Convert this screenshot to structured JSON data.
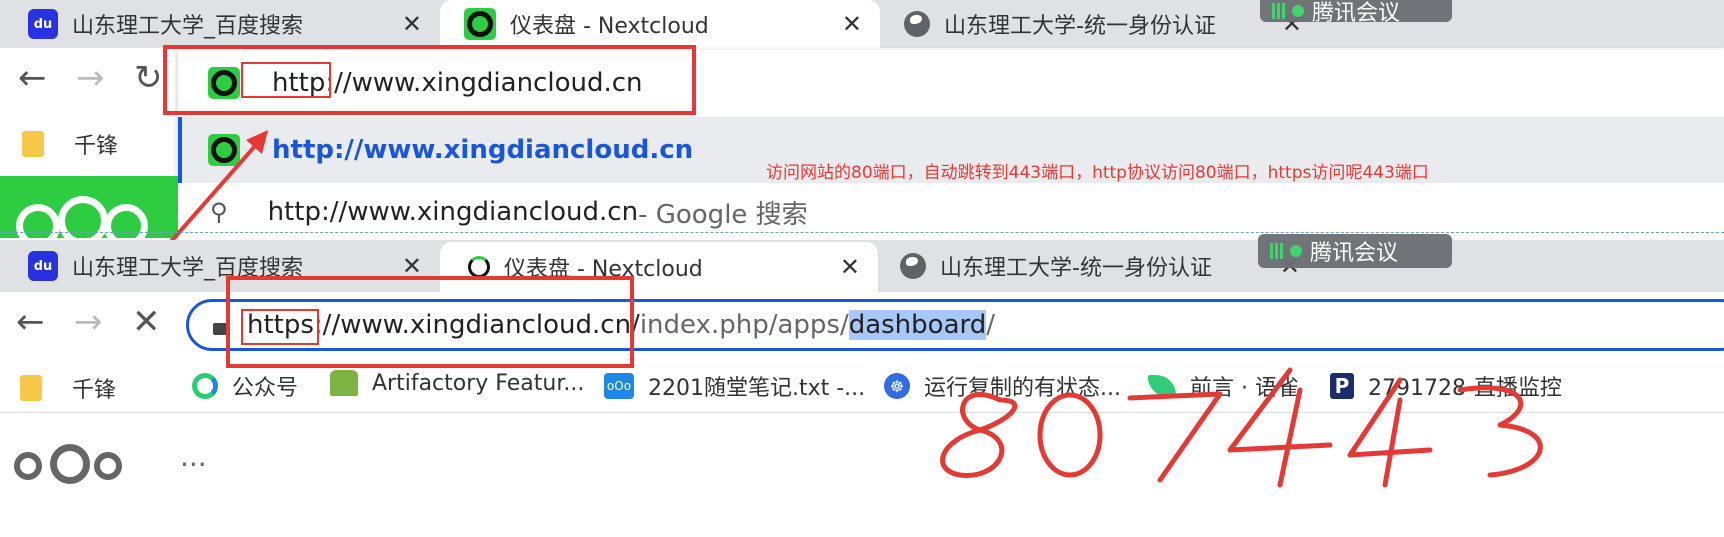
{
  "top_window": {
    "tabs": [
      {
        "title": "山东理工大学_百度搜索",
        "icon": "baidu-icon"
      },
      {
        "title": "仪表盘 - Nextcloud",
        "icon": "nextcloud-icon"
      },
      {
        "title": "山东理工大学-统一身份认证",
        "icon": "globe-icon"
      }
    ],
    "meeting_label": "腾讯会议",
    "address_text": "http://www.xingdiancloud.cn",
    "suggestions": [
      {
        "text": "http://www.xingdiancloud.cn",
        "icon": "nextcloud-icon"
      },
      {
        "text": "http://www.xingdiancloud.cn",
        "suffix": " - Google 搜索",
        "icon": "search-icon"
      }
    ],
    "bookmark_label": "千锋"
  },
  "annotation_note": "访问网站的80端口，自动跳转到443端口，http协议访问80端口，https访问呢443端口",
  "bottom_window": {
    "tabs": [
      {
        "title": "山东理工大学_百度搜索",
        "icon": "baidu-icon"
      },
      {
        "title": "仪表盘 - Nextcloud",
        "icon": "nextcloud-icon"
      },
      {
        "title": "山东理工大学-统一身份认证",
        "icon": "globe-icon"
      }
    ],
    "meeting_label": "腾讯会议",
    "url_parts": {
      "scheme": "https",
      "host": "://www.xingdiancloud.cn/",
      "path_before": "index.php/apps/",
      "selected": "dashboard",
      "path_after": "/"
    },
    "bookmarks": [
      "千锋",
      "公众号",
      "Artifactory Featur...",
      "2201随堂笔记.txt -...",
      "运行复制的有状态...",
      "前言 · 语雀",
      "2791728-直播监控"
    ],
    "dots": "···"
  },
  "handwriting": "80 443",
  "colors": {
    "annotation_red": "#e53935",
    "selection_blue": "#a8c7fa",
    "tabbar_gray": "#dfe1e5",
    "nextcloud_green": "#2ecc40",
    "link_blue": "#1a56db"
  }
}
